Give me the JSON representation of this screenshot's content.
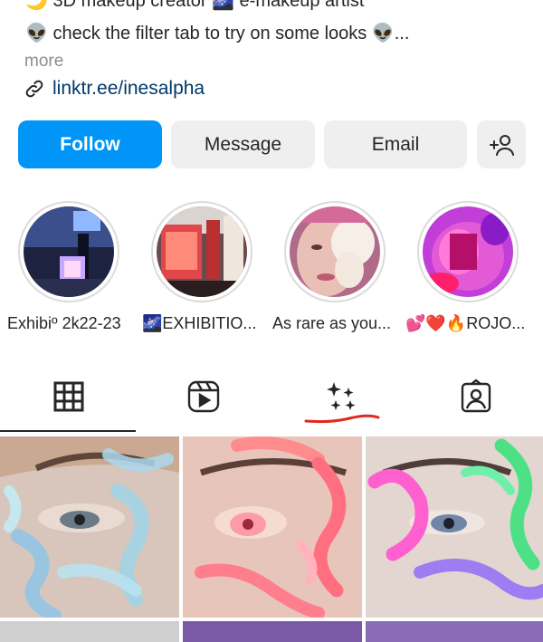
{
  "bio": {
    "line1": "🌙 3D makeup creator 🌌 e-makeup artist",
    "line2": "👽 check the filter tab to try on some looks 👽...",
    "more": "more",
    "link": "linktr.ee/inesalpha"
  },
  "buttons": {
    "follow": "Follow",
    "message": "Message",
    "email": "Email"
  },
  "highlights": [
    {
      "label": "Exhibiº 2k22-23"
    },
    {
      "label": "🌌EXHIBITIO..."
    },
    {
      "label": "As rare as you..."
    },
    {
      "label": "💕❤️🔥ROJO..."
    }
  ],
  "tabs": [
    "grid",
    "reels",
    "effects",
    "tagged"
  ],
  "colors": {
    "accent": "#0095f6",
    "button_gray": "#efefef",
    "link": "#00376b"
  }
}
